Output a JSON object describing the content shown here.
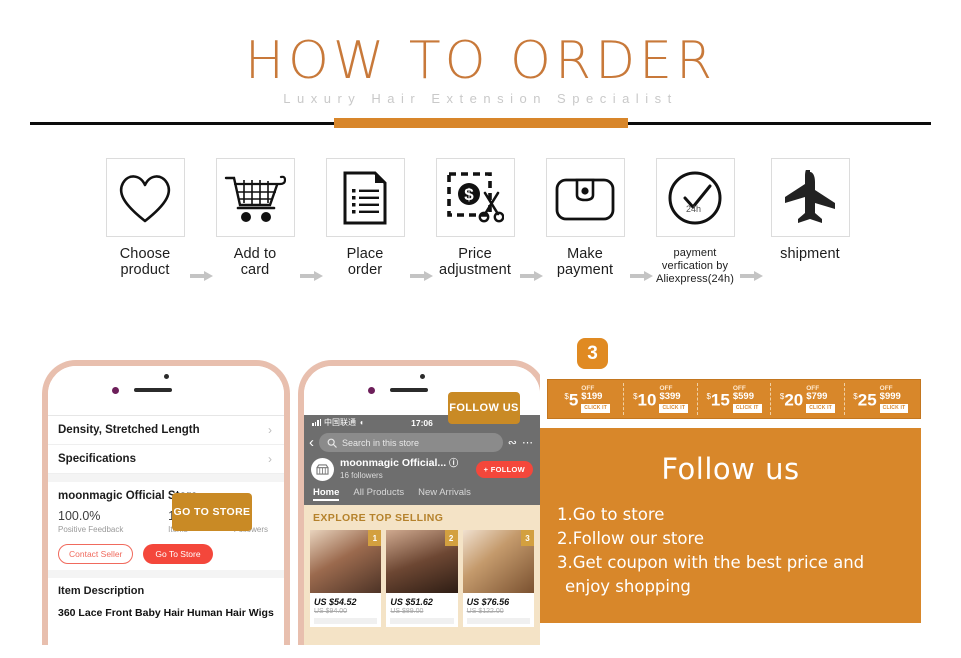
{
  "header": {
    "title": "HOW TO ORDER",
    "subtitle": "Luxury Hair Extension Specialist"
  },
  "colors": {
    "accent_orange": "#d8872a",
    "title_orange": "#c8793a",
    "callout_orange": "#c98a25",
    "badge_orange": "#e08a22",
    "red_button": "#f4473b",
    "phone_bezel": "#e8bfae"
  },
  "steps": [
    {
      "icon": "heart-icon",
      "label_line1": "Choose",
      "label_line2": "product"
    },
    {
      "icon": "cart-icon",
      "label_line1": "Add to",
      "label_line2": "card"
    },
    {
      "icon": "document-icon",
      "label_line1": "Place",
      "label_line2": "order"
    },
    {
      "icon": "coupon-scissors-icon",
      "label_line1": "Price",
      "label_line2": "adjustment"
    },
    {
      "icon": "wallet-icon",
      "label_line1": "Make",
      "label_line2": "payment"
    },
    {
      "icon": "clock-check-icon",
      "label_line1": "payment",
      "label_line2": "verfication by",
      "label_line3": "Aliexpress(24h)",
      "icon_text": "24h"
    },
    {
      "icon": "airplane-icon",
      "label_line1": "shipment",
      "label_line2": ""
    }
  ],
  "phone1": {
    "rows": [
      {
        "label": "Density, Stretched Length",
        "chevron": "›"
      },
      {
        "label": "Specifications",
        "chevron": "›"
      }
    ],
    "store_name": "moonmagic Official Store",
    "stats": [
      {
        "num": "100.0%",
        "caption": "Positive Feedback"
      },
      {
        "num": "157",
        "caption": "Items"
      },
      {
        "num": "16",
        "caption": "Followers"
      }
    ],
    "contact_button": "Contact Seller",
    "store_button": "Go To Store",
    "description_heading": "Item Description",
    "description_text": "360 Lace Front Baby Hair Human Hair Wigs",
    "callout": "GO TO STORE"
  },
  "phone2": {
    "status": {
      "carrier": "中国联通",
      "time": "17:06"
    },
    "search_placeholder": "Search in this store",
    "store_name": "moonmagic Official...",
    "followers": "16 followers",
    "follow_button": "+ FOLLOW",
    "tabs": [
      {
        "label": "Home",
        "active": true
      },
      {
        "label": "All Products",
        "active": false
      },
      {
        "label": "New Arrivals",
        "active": false
      }
    ],
    "section_title": "EXPLORE TOP SELLING",
    "products": [
      {
        "rank": "1",
        "price": "US $54.52",
        "old_price": "US $94.00"
      },
      {
        "rank": "2",
        "price": "US $51.62",
        "old_price": "US $89.00"
      },
      {
        "rank": "3",
        "price": "US $76.56",
        "old_price": "US $122.00"
      }
    ],
    "callout": "FOLLOW US"
  },
  "right_panel": {
    "step_badge": "3",
    "coupons": [
      {
        "amount": "5",
        "currency": "$",
        "off_label": "OFF",
        "min": "$199",
        "click": "CLICK IT"
      },
      {
        "amount": "10",
        "currency": "$",
        "off_label": "OFF",
        "min": "$399",
        "click": "CLICK IT"
      },
      {
        "amount": "15",
        "currency": "$",
        "off_label": "OFF",
        "min": "$599",
        "click": "CLICK IT"
      },
      {
        "amount": "20",
        "currency": "$",
        "off_label": "OFF",
        "min": "$799",
        "click": "CLICK IT"
      },
      {
        "amount": "25",
        "currency": "$",
        "off_label": "OFF",
        "min": "$999",
        "click": "CLICK IT"
      }
    ],
    "title": "Follow us",
    "instructions": [
      {
        "line1": "1.Go to store",
        "line2": ""
      },
      {
        "line1": "2.Follow our store",
        "line2": ""
      },
      {
        "line1": "3.Get coupon with the best price and",
        "line2": "enjoy shopping"
      }
    ]
  }
}
